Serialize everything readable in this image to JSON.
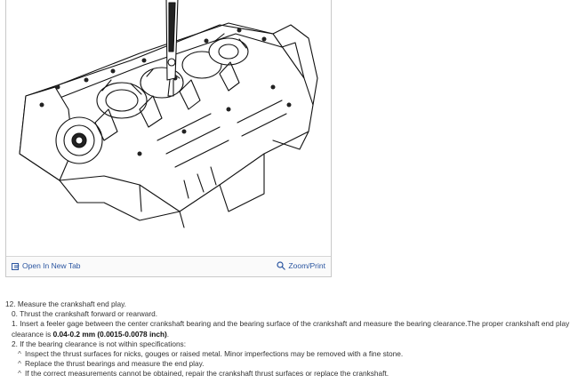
{
  "toolbar": {
    "open_tab_label": "Open In New Tab",
    "zoom_label": "Zoom/Print",
    "open_tab_icon": "external-link-icon",
    "zoom_icon": "magnifier-icon"
  },
  "figure": {
    "description_icon": "engine-block-illustration"
  },
  "instructions": {
    "step_title": "12. Measure the crankshaft end play.",
    "sub0": "0. Thrust the crankshaft forward or rearward.",
    "sub1_prefix": "1. Insert a feeler gage between the center crankshaft bearing and the bearing surface of the crankshaft and measure the bearing clearance.The proper crankshaft end play clearance is ",
    "sub1_value": "0.04-0.2 mm (0.0015-0.0078 inch)",
    "sub1_suffix": ".",
    "sub2": "2. If the bearing clearance is not within specifications:",
    "bullet_mark": "^",
    "bullets": [
      "Inspect the thrust surfaces for nicks, gouges or raised metal. Minor imperfections may be removed with a fine stone.",
      "Replace the thrust bearings and measure the end play.",
      "If the correct measurements cannot be obtained, repair the crankshaft thrust surfaces or replace the crankshaft."
    ]
  }
}
